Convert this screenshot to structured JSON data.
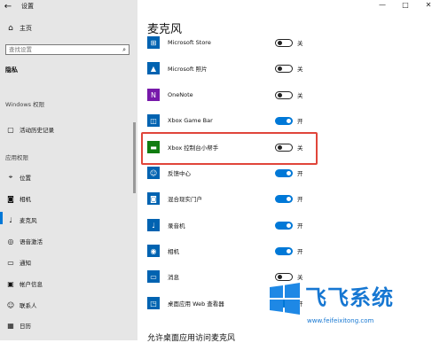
{
  "window": {
    "title": "设置"
  },
  "sidebar": {
    "home": "主页",
    "search_placeholder": "查找设置",
    "privacy": "隐私",
    "section_windows": "Windows 权限",
    "activity": "活动历史记录",
    "section_app": "应用权限",
    "items": [
      "位置",
      "相机",
      "麦克风",
      "语音激活",
      "通知",
      "帐户信息",
      "联系人",
      "日历"
    ]
  },
  "main": {
    "title": "麦克风",
    "apps": [
      {
        "name": "Microsoft Store",
        "state": "关",
        "on": false,
        "icon": "store-icon"
      },
      {
        "name": "Microsoft 照片",
        "state": "关",
        "on": false,
        "icon": "photos-icon"
      },
      {
        "name": "OneNote",
        "state": "关",
        "on": false,
        "icon": "onenote-icon"
      },
      {
        "name": "Xbox Game Bar",
        "state": "开",
        "on": true,
        "icon": "xbox-gamebar-icon"
      },
      {
        "name": "Xbox 控制台小帮手",
        "state": "关",
        "on": false,
        "icon": "xbox-companion-icon"
      },
      {
        "name": "反馈中心",
        "state": "开",
        "on": true,
        "icon": "feedback-icon"
      },
      {
        "name": "混合现实门户",
        "state": "开",
        "on": true,
        "icon": "mixed-reality-icon"
      },
      {
        "name": "录音机",
        "state": "开",
        "on": true,
        "icon": "recorder-icon"
      },
      {
        "name": "相机",
        "state": "开",
        "on": true,
        "icon": "camera-icon"
      },
      {
        "name": "消息",
        "state": "关",
        "on": false,
        "icon": "message-icon"
      },
      {
        "name": "桌面应用 Web 查看器",
        "state": "开",
        "on": true,
        "icon": "web-viewer-icon"
      }
    ],
    "bottom_heading": "允许桌面应用访问麦克风"
  },
  "watermark": {
    "brand": "飞飞系统",
    "url": "www.feifeixitong.com"
  },
  "colors": {
    "accent": "#0078d7",
    "highlight": "#e0453a",
    "sidebar_bg": "#e6e6e6"
  }
}
